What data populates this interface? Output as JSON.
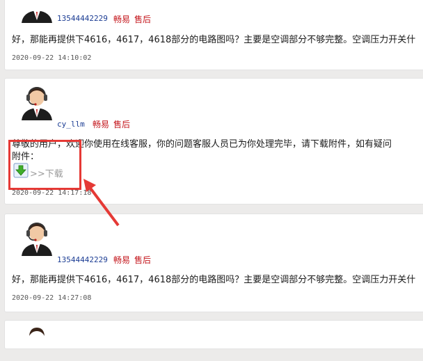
{
  "posts": [
    {
      "username": "13544442229",
      "tag1": "畅易",
      "tag2": "售后",
      "message": "好，那能再提供下4616，4617，4618部分的电路图吗？主要是空调部分不够完整。空调压力开关什",
      "time": "2020-09-22 14:10:02"
    },
    {
      "username": "cy_llm",
      "tag1": "畅易",
      "tag2": "售后",
      "message": "尊敬的用户，欢迎你使用在线客服，你的问题客服人员已为你处理完毕，请下载附件，如有疑问",
      "attachment_label": "附件：",
      "download_text": ">>下载",
      "time": "2020-09-22 14:17:18"
    },
    {
      "username": "13544442229",
      "tag1": "畅易",
      "tag2": "售后",
      "message": "好，那能再提供下4616，4617，4618部分的电路图吗？主要是空调部分不够完整。空调压力开关什",
      "time": "2020-09-22 14:27:08"
    }
  ],
  "colors": {
    "highlight": "#e53935",
    "tag": "#c4161c",
    "username": "#1b3c93"
  }
}
